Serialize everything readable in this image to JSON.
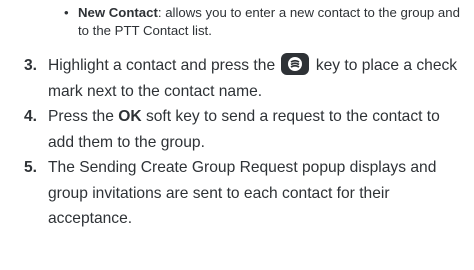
{
  "bullet": {
    "dot": "•",
    "term": "New Contact",
    "text": ": allows you to enter a new contact to the group and to the PTT Contact list."
  },
  "steps": [
    {
      "number": "3.",
      "before": "Highlight a contact and press the",
      "icon": "center-select-key-icon",
      "after": "key to place a check mark next to the contact name."
    },
    {
      "number": "4.",
      "before": "Press the",
      "bold": "OK",
      "after": "soft key to send a request to the contact to add them to the group."
    },
    {
      "number": "5.",
      "text": "The Sending Create Group Request popup displays and group invitations are sent to each contact for their acceptance."
    }
  ]
}
